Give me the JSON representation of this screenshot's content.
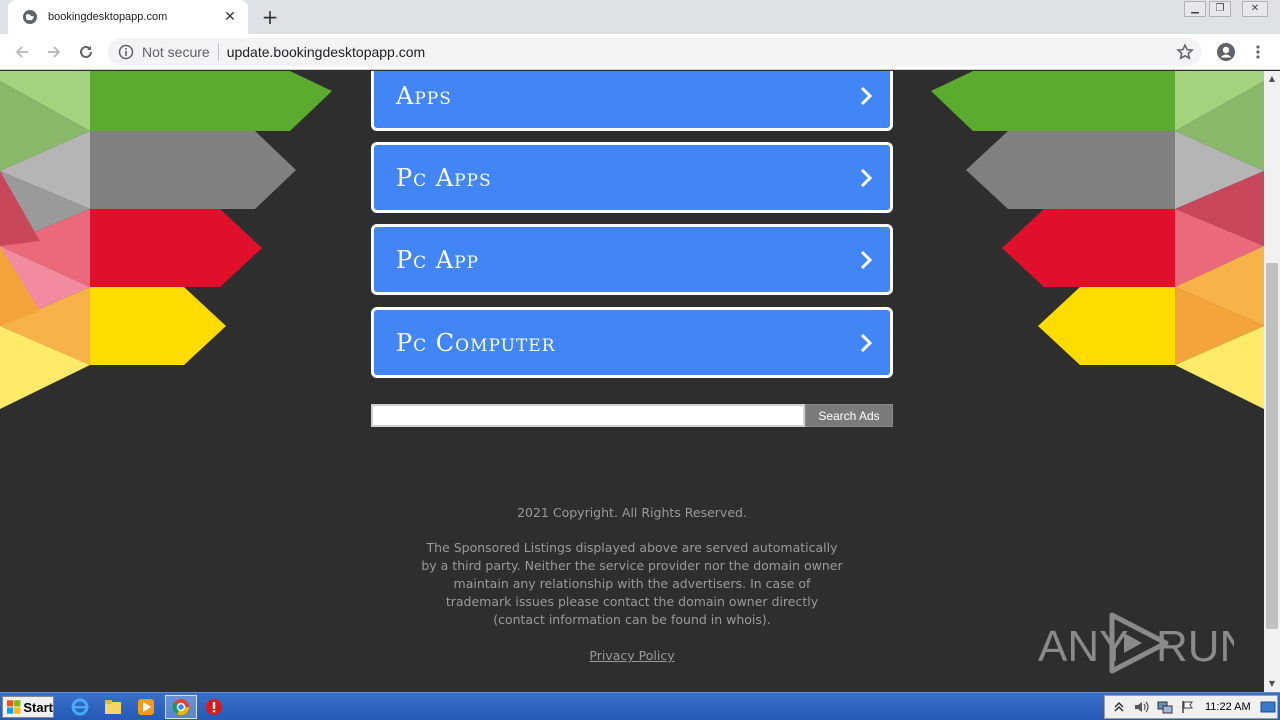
{
  "browser": {
    "tab_title": "bookingdesktopapp.com",
    "security_label": "Not secure",
    "url": "update.bookingdesktopapp.com"
  },
  "page": {
    "menu_items": [
      {
        "label": "Apps"
      },
      {
        "label": "Pc Apps"
      },
      {
        "label": "Pc App"
      },
      {
        "label": "Pc Computer"
      }
    ],
    "search_button_label": "Search Ads",
    "copyright": "2021 Copyright. All Rights Reserved.",
    "disclaimer_lines": [
      "The Sponsored Listings displayed above are served automatically",
      "by a third party. Neither the service provider nor the domain owner",
      "maintain any relationship with the advertisers. In case of",
      "trademark issues please contact the domain owner directly",
      "(contact information can be found in whois)."
    ],
    "privacy_label": "Privacy Policy"
  },
  "watermark": {
    "text_left": "ANY",
    "text_right": "RUN"
  },
  "taskbar": {
    "start_label": "Start",
    "clock": "11:22 AM"
  },
  "colors": {
    "button_blue": "#4285f4",
    "page_background": "#2e2e2e",
    "green": "#5aab2f",
    "gray": "#808080",
    "red": "#e0102d",
    "yellow": "#ffdc00"
  }
}
